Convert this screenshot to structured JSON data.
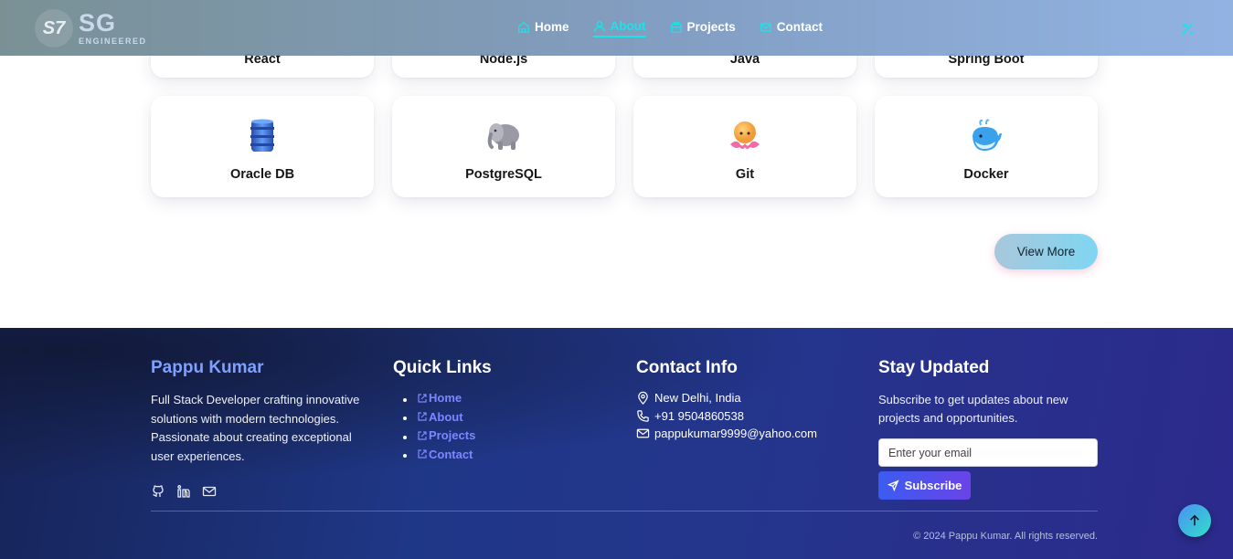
{
  "navbar": {
    "logo_mark": "S7",
    "logo_title": "SG",
    "logo_subtitle": "ENGINEERED",
    "items": [
      {
        "label": "Home",
        "icon": "home-icon",
        "active": false
      },
      {
        "label": "About",
        "icon": "user-icon",
        "active": true
      },
      {
        "label": "Projects",
        "icon": "folder-icon",
        "active": false
      },
      {
        "label": "Contact",
        "icon": "mail-icon",
        "active": false
      }
    ],
    "active_color": "#19e4e8"
  },
  "skills": {
    "row1": [
      "React",
      "Node.js",
      "Java",
      "Spring Boot"
    ],
    "row2": [
      {
        "label": "Oracle DB",
        "icon": "database-barrel-icon"
      },
      {
        "label": "PostgreSQL",
        "icon": "elephant-icon"
      },
      {
        "label": "Git",
        "icon": "octopus-icon"
      },
      {
        "label": "Docker",
        "icon": "whale-icon"
      }
    ],
    "view_more_label": "View More"
  },
  "footer": {
    "about": {
      "name": "Pappu Kumar",
      "description": "Full Stack Developer crafting innovative solutions with modern technologies. Passionate about creating exceptional user experiences.",
      "socials": [
        "github-icon",
        "linkedin-icon",
        "mail-icon"
      ]
    },
    "quick_links": {
      "title": "Quick Links",
      "links": [
        "Home",
        "About",
        "Projects",
        "Contact"
      ]
    },
    "contact": {
      "title": "Contact Info",
      "location": "New Delhi, India",
      "phone": "+91 9504860538",
      "email": "pappukumar9999@yahoo.com"
    },
    "newsletter": {
      "title": "Stay Updated",
      "text": "Subscribe to get updates about new projects and opportunities.",
      "placeholder": "Enter your email",
      "button_label": "Subscribe"
    },
    "copyright": "© 2024 Pappu Kumar. All rights reserved."
  }
}
